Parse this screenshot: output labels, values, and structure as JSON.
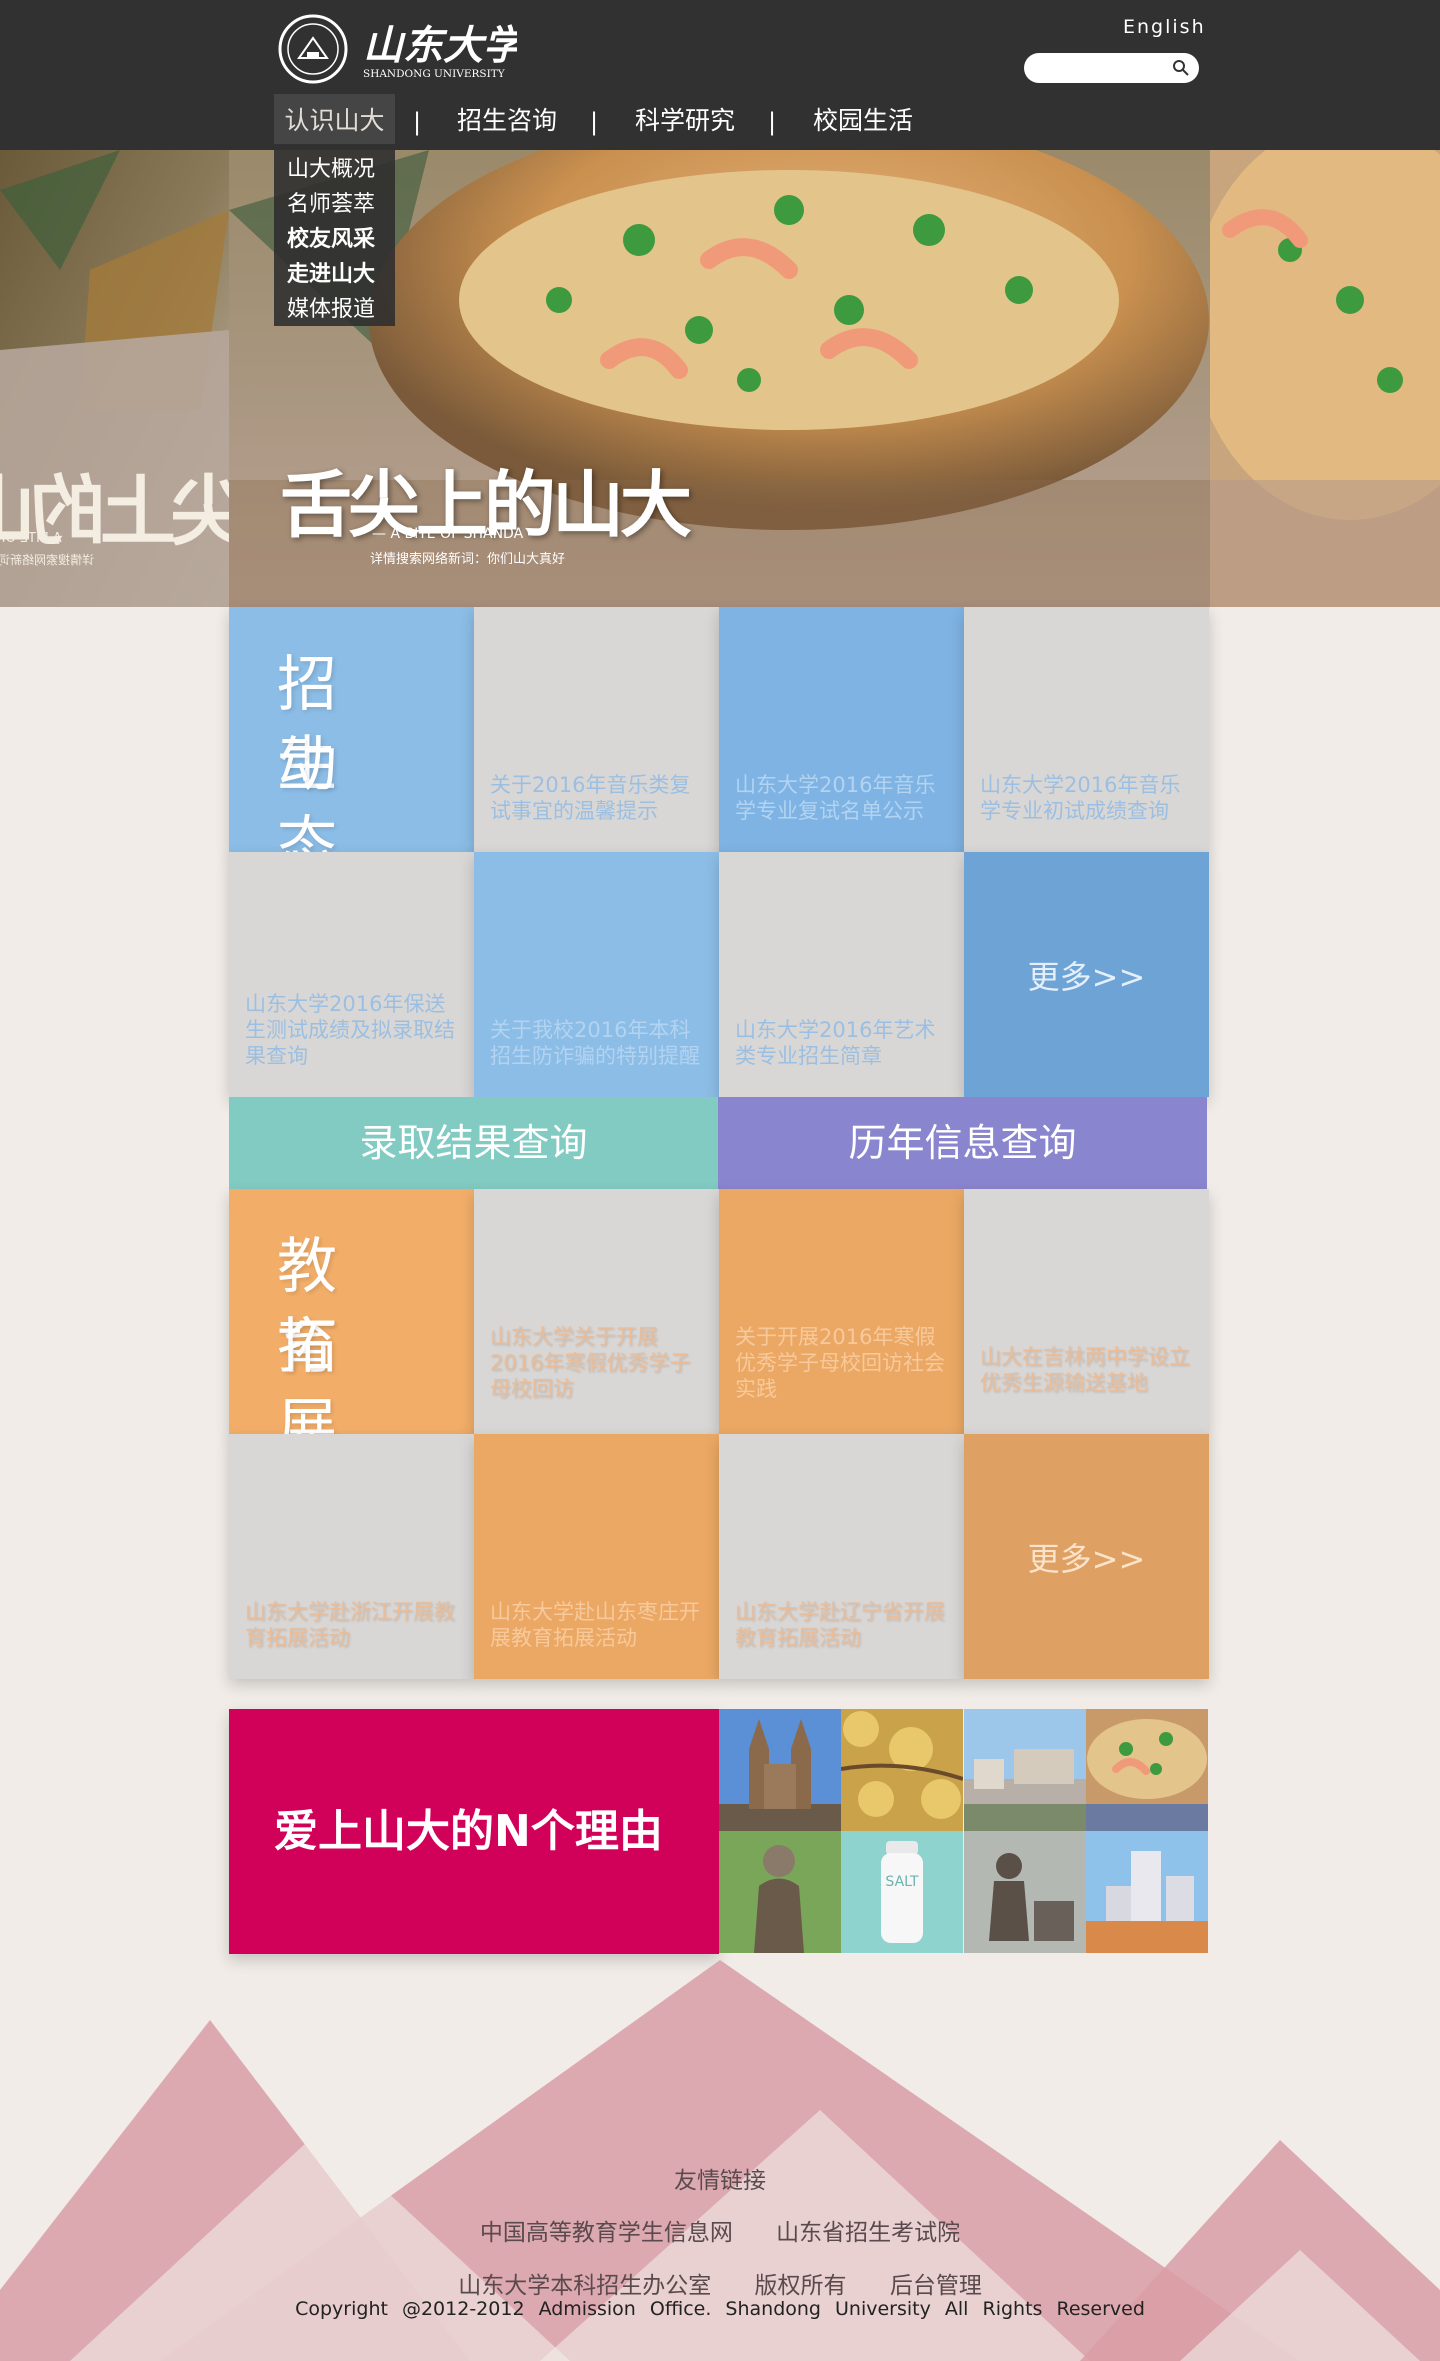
{
  "header": {
    "logo_cn": "山东大学",
    "logo_en": "SHANDONG UNIVERSITY",
    "english_label": "English",
    "search_placeholder": ""
  },
  "nav": {
    "items": [
      "认识山大",
      "招生咨询",
      "科学研究",
      "校园生活"
    ],
    "separator": "|",
    "active_index": 0,
    "dropdown": [
      "山大概况",
      "名师荟萃",
      "校友风采",
      "走进山大",
      "媒体报道"
    ]
  },
  "banner": {
    "title": "舌尖上的山大",
    "subtitle": "— A BITE OF SHANDA —",
    "caption": "详情搜索网络新词：你们山大真好"
  },
  "admissions": {
    "heading_line1": "招 生",
    "heading_line2": "动 态",
    "news": [
      "关于2016年音乐类复试事宜的温馨提示",
      "山东大学2016年音乐学专业复试名单公示",
      "山东大学2016年音乐学专业初试成绩查询",
      "山东大学2016年保送生测试成绩及拟录取结果查询",
      "关于我校2016年本科招生防诈骗的特别提醒",
      "山东大学2016年艺术类专业招生简章"
    ],
    "more": "更多>>"
  },
  "queries": {
    "admission_result": "录取结果查询",
    "history_info": "历年信息查询"
  },
  "education": {
    "heading_line1": "教 育",
    "heading_line2": "拓 展",
    "news": [
      "山东大学关于开展2016年寒假优秀学子母校回访",
      "关于开展2016年寒假优秀学子母校回访社会实践",
      "山大在吉林两中学设立优秀生源输送基地",
      "山东大学赴浙江开展教育拓展活动",
      "山东大学赴山东枣庄开展教育拓展活动",
      "山东大学赴辽宁省开展教育拓展活动"
    ],
    "more": "更多>>"
  },
  "reasons": {
    "label": "爱上山大的N个理由",
    "salt_text": "SALT"
  },
  "footer": {
    "links_title": "友情链接",
    "links": [
      "中国高等教育学生信息网",
      "山东省招生考试院"
    ],
    "info": [
      "山东大学本科招生办公室",
      "版权所有",
      "后台管理"
    ],
    "copyright": "Copyright @2012-2012 Admission Office. Shandong University All Rights Reserved"
  },
  "colors": {
    "header_bg": "#313131",
    "page_bg": "#f1ece8",
    "blue_tile": "#8cbde6",
    "orange_tile": "#f2ae69",
    "teal_query": "#82cbc3",
    "purple_query": "#8a85cf",
    "reasons_red": "#d1015a",
    "mountain_pink": "#d99ea6"
  }
}
